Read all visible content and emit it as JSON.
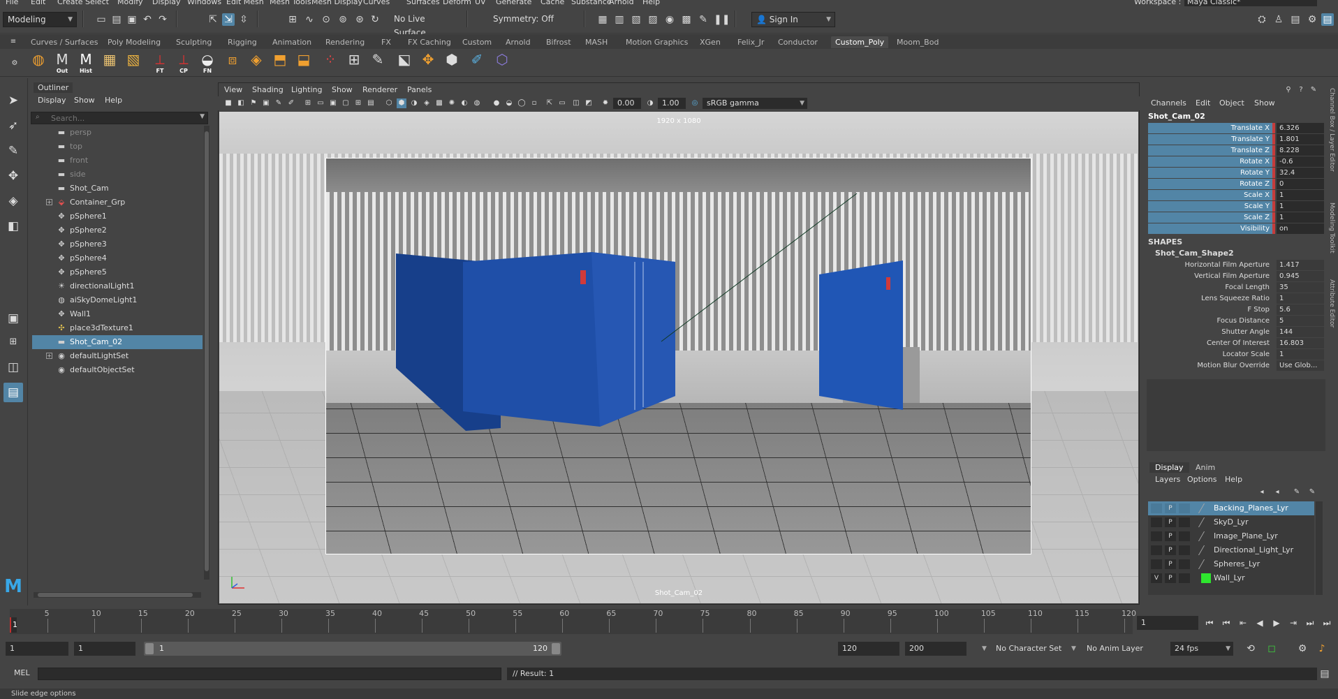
{
  "menubar": {
    "items": [
      "File",
      "Edit",
      "Create",
      "Select",
      "Modify",
      "Display",
      "Windows",
      "Edit Mesh",
      "Mesh Tools",
      "Mesh Display",
      "Curves",
      "Surfaces",
      "Deform",
      "UV",
      "Generate",
      "Cache",
      "Substance",
      "Arnold",
      "Help"
    ],
    "workspace_label": "Workspace :",
    "workspace_value": "Maya Classic*"
  },
  "statusline": {
    "menuset": "Modeling",
    "live_surface": "No Live Surface",
    "symmetry": "Symmetry: Off",
    "sign_in": "Sign In"
  },
  "shelf": {
    "tabs": [
      "Curves / Surfaces",
      "Poly Modeling",
      "Sculpting",
      "Rigging",
      "Animation",
      "Rendering",
      "FX",
      "FX Caching",
      "Custom",
      "Arnold",
      "Bifrost",
      "MASH",
      "Motion Graphics",
      "XGen",
      "Felix_Jr",
      "Conductor",
      "Custom_Poly",
      "Moom_Bod"
    ],
    "active_tab": "Custom_Poly",
    "icon_labels": [
      "Out",
      "Hist",
      "FT",
      "CP",
      "FN"
    ]
  },
  "outliner": {
    "title": "Outliner",
    "menu": [
      "Display",
      "Show",
      "Help"
    ],
    "search_placeholder": "Search...",
    "items": [
      {
        "name": "persp",
        "icon": "camera-icon",
        "dim": true
      },
      {
        "name": "top",
        "icon": "camera-icon",
        "dim": true
      },
      {
        "name": "front",
        "icon": "camera-icon",
        "dim": true
      },
      {
        "name": "side",
        "icon": "camera-icon",
        "dim": true
      },
      {
        "name": "Shot_Cam",
        "icon": "camera-icon",
        "dim": false
      },
      {
        "name": "Container_Grp",
        "icon": "group-icon",
        "dim": false,
        "expandable": true
      },
      {
        "name": "pSphere1",
        "icon": "transform-icon",
        "dim": false
      },
      {
        "name": "pSphere2",
        "icon": "transform-icon",
        "dim": false
      },
      {
        "name": "pSphere3",
        "icon": "transform-icon",
        "dim": false
      },
      {
        "name": "pSphere4",
        "icon": "transform-icon",
        "dim": false
      },
      {
        "name": "pSphere5",
        "icon": "transform-icon",
        "dim": false
      },
      {
        "name": "directionalLight1",
        "icon": "light-icon",
        "dim": false
      },
      {
        "name": "aiSkyDomeLight1",
        "icon": "skydome-icon",
        "dim": false
      },
      {
        "name": "Wall1",
        "icon": "transform-icon",
        "dim": false
      },
      {
        "name": "place3dTexture1",
        "icon": "texture-icon",
        "dim": false
      },
      {
        "name": "Shot_Cam_02",
        "icon": "camera-icon",
        "dim": false,
        "selected": true
      },
      {
        "name": "defaultLightSet",
        "icon": "set-icon",
        "dim": false,
        "expandable": true
      },
      {
        "name": "defaultObjectSet",
        "icon": "set-icon",
        "dim": false
      }
    ]
  },
  "viewport": {
    "menu": [
      "View",
      "Shading",
      "Lighting",
      "Show",
      "Renderer",
      "Panels"
    ],
    "exposure": "0.00",
    "gamma": "1.00",
    "color_space": "sRGB gamma",
    "resolution_label": "1920 x 1080",
    "camera_name": "Shot_Cam_02"
  },
  "channelbox": {
    "menu": [
      "Channels",
      "Edit",
      "Object",
      "Show"
    ],
    "object": "Shot_Cam_02",
    "channels": [
      {
        "label": "Translate X",
        "value": "6.326"
      },
      {
        "label": "Translate Y",
        "value": "1.801"
      },
      {
        "label": "Translate Z",
        "value": "8.228"
      },
      {
        "label": "Rotate X",
        "value": "-0.6"
      },
      {
        "label": "Rotate Y",
        "value": "32.4"
      },
      {
        "label": "Rotate Z",
        "value": "0"
      },
      {
        "label": "Scale X",
        "value": "1"
      },
      {
        "label": "Scale Y",
        "value": "1"
      },
      {
        "label": "Scale Z",
        "value": "1"
      },
      {
        "label": "Visibility",
        "value": "on"
      }
    ],
    "shapes_header": "SHAPES",
    "shape_name": "Shot_Cam_Shape2",
    "shape_attrs": [
      {
        "label": "Horizontal Film Aperture",
        "value": "1.417"
      },
      {
        "label": "Vertical Film Aperture",
        "value": "0.945"
      },
      {
        "label": "Focal Length",
        "value": "35"
      },
      {
        "label": "Lens Squeeze Ratio",
        "value": "1"
      },
      {
        "label": "F Stop",
        "value": "5.6"
      },
      {
        "label": "Focus Distance",
        "value": "5"
      },
      {
        "label": "Shutter Angle",
        "value": "144"
      },
      {
        "label": "Center Of Interest",
        "value": "16.803"
      },
      {
        "label": "Locator Scale",
        "value": "1"
      },
      {
        "label": "Motion Blur Override",
        "value": "Use Glob..."
      }
    ],
    "side_tabs": [
      "Channel Box / Layer Editor",
      "Modeling Toolkit",
      "Attribute Editor"
    ]
  },
  "layers": {
    "tabs": [
      "Display",
      "Anim"
    ],
    "menu": [
      "Layers",
      "Options",
      "Help"
    ],
    "items": [
      {
        "name": "Backing_Planes_Lyr",
        "v": "",
        "p": "P",
        "color": "",
        "selected": true
      },
      {
        "name": "SkyD_Lyr",
        "v": "",
        "p": "P",
        "color": ""
      },
      {
        "name": "Image_Plane_Lyr",
        "v": "",
        "p": "P",
        "color": ""
      },
      {
        "name": "Directional_Light_Lyr",
        "v": "",
        "p": "P",
        "color": ""
      },
      {
        "name": "Spheres_Lyr",
        "v": "",
        "p": "P",
        "color": ""
      },
      {
        "name": "Wall_Lyr",
        "v": "V",
        "p": "P",
        "color": "#2ee62e"
      }
    ]
  },
  "timeline": {
    "ticks": [
      "5",
      "10",
      "15",
      "20",
      "25",
      "30",
      "35",
      "40",
      "45",
      "50",
      "55",
      "60",
      "65",
      "70",
      "75",
      "80",
      "85",
      "90",
      "95",
      "100",
      "105",
      "110",
      "115",
      "120"
    ],
    "current_frame_marker": "1",
    "current_frame": "1",
    "range_start": "1",
    "playback_start": "1",
    "range_slider_start": "1",
    "range_slider_end": "120",
    "playback_end": "120",
    "anim_end": "200",
    "character_set": "No Character Set",
    "anim_layer": "No Anim Layer",
    "fps": "24 fps"
  },
  "cmdline": {
    "label": "MEL",
    "result": "// Result: 1"
  },
  "helpline": "Slide edge options"
}
